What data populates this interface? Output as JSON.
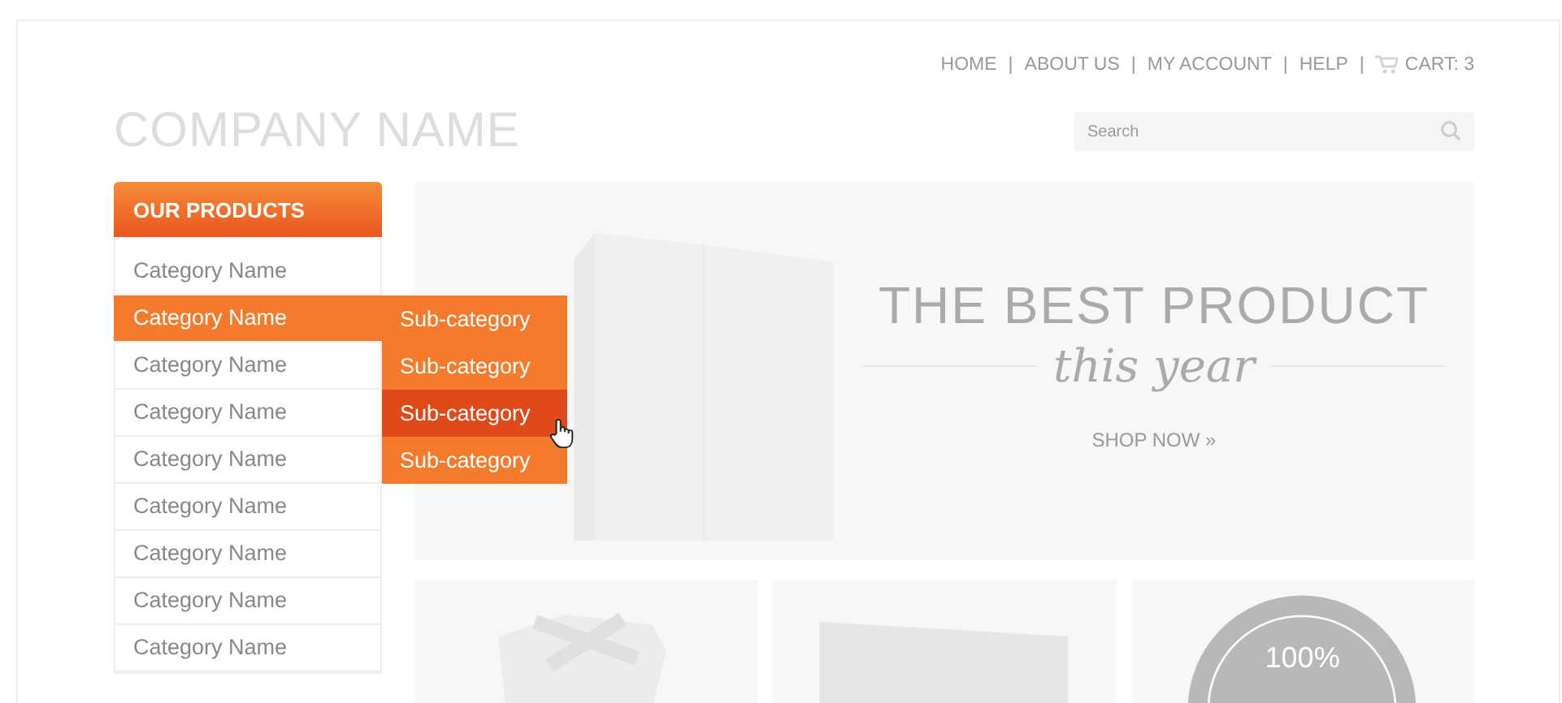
{
  "nav": {
    "links": [
      {
        "label": "HOME"
      },
      {
        "label": "ABOUT US"
      },
      {
        "label": "MY ACCOUNT"
      },
      {
        "label": "HELP"
      }
    ],
    "separator": "|",
    "cart": "CART: 3"
  },
  "logo": "COMPANY NAME",
  "search": {
    "placeholder": "Search"
  },
  "sidebar": {
    "title": "OUR PRODUCTS",
    "categories": [
      {
        "label": "Category Name",
        "selected": false
      },
      {
        "label": "Category Name",
        "selected": true
      },
      {
        "label": "Category Name",
        "selected": false
      },
      {
        "label": "Category Name",
        "selected": false
      },
      {
        "label": "Category Name",
        "selected": false
      },
      {
        "label": "Category Name",
        "selected": false
      },
      {
        "label": "Category Name",
        "selected": false
      },
      {
        "label": "Category Name",
        "selected": false
      },
      {
        "label": "Category Name",
        "selected": false
      }
    ],
    "subcategories": [
      {
        "label": "Sub-category",
        "selected": false
      },
      {
        "label": "Sub-category",
        "selected": false
      },
      {
        "label": "Sub-category",
        "selected": true
      },
      {
        "label": "Sub-category",
        "selected": false
      }
    ]
  },
  "hero": {
    "headline": "THE BEST PRODUCT",
    "tagline": "this year",
    "link": "SHOP NOW »"
  },
  "tiles": [
    {
      "kind": "gift"
    },
    {
      "kind": "card"
    },
    {
      "kind": "seal",
      "badge": "100%"
    }
  ]
}
